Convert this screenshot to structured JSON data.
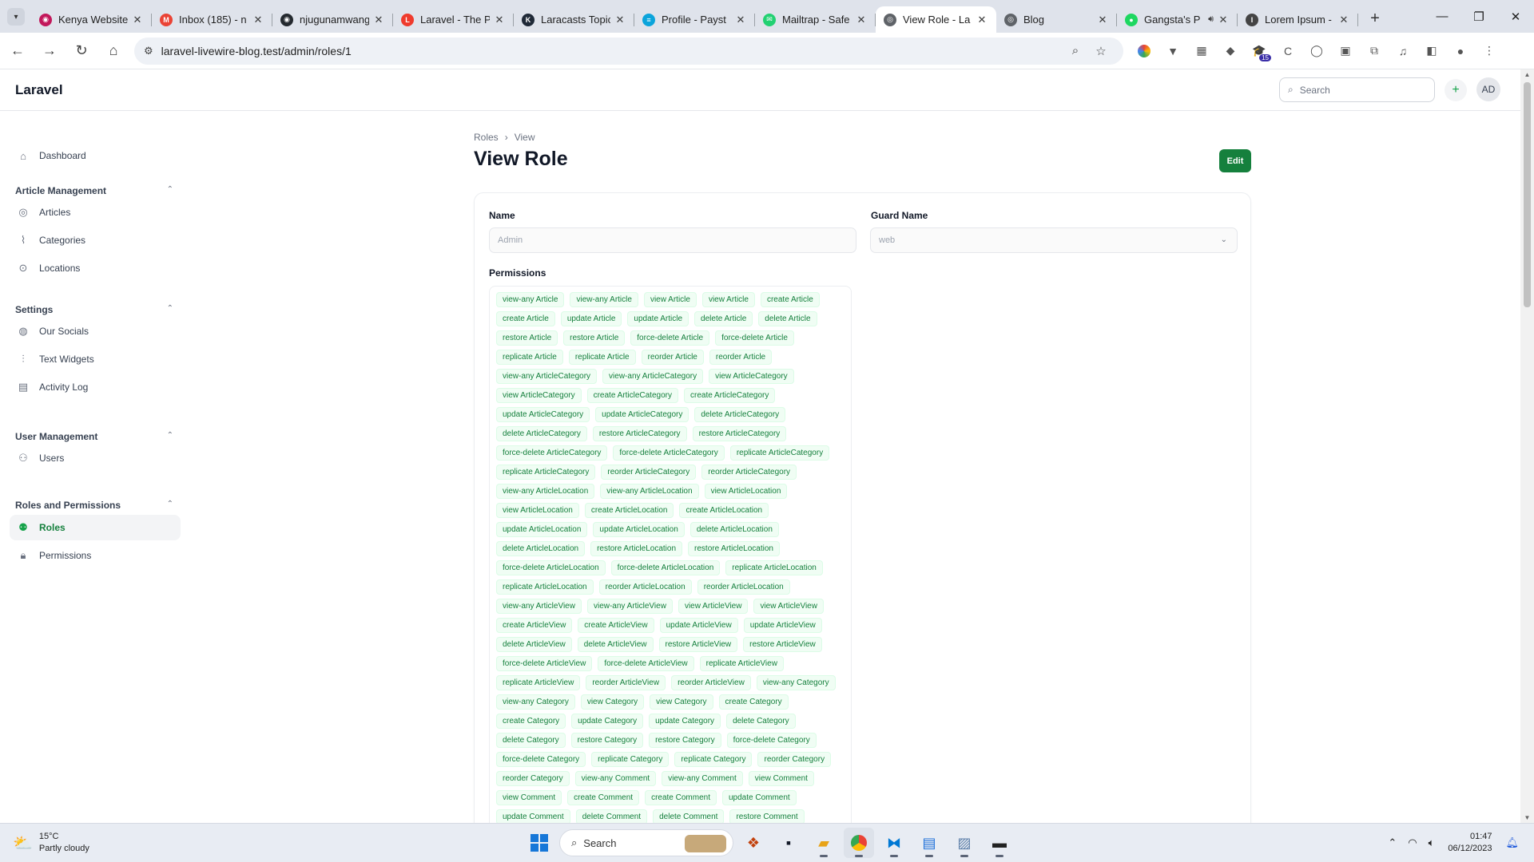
{
  "browser": {
    "tabs": [
      {
        "title": "Kenya Website",
        "favicon_color": "#c2185b",
        "favicon": "◉"
      },
      {
        "title": "Inbox (185) - n",
        "favicon_color": "#ea4335",
        "favicon": "M"
      },
      {
        "title": "njugunamwang",
        "favicon_color": "#24292f",
        "favicon": "◉"
      },
      {
        "title": "Laravel - The P",
        "favicon_color": "#ef3b2d",
        "favicon": "L"
      },
      {
        "title": "Laracasts Topic",
        "favicon_color": "#1f2937",
        "favicon": "K"
      },
      {
        "title": "Profile - Payst",
        "favicon_color": "#0ba4db",
        "favicon": "≡"
      },
      {
        "title": "Mailtrap - Safe",
        "favicon_color": "#22d172",
        "favicon": "✉"
      },
      {
        "title": "View Role - La",
        "favicon_color": "#5f6368",
        "favicon": "◎",
        "active": true
      },
      {
        "title": "Blog",
        "favicon_color": "#5f6368",
        "favicon": "◎"
      },
      {
        "title": "Gangsta's P",
        "favicon_color": "#1ed760",
        "favicon": "●",
        "audio": true
      },
      {
        "title": "Lorem Ipsum -",
        "favicon_color": "#444444",
        "favicon": "I"
      }
    ],
    "url": "laravel-livewire-blog.test/admin/roles/1",
    "extension_badge": "15"
  },
  "app": {
    "brand": "Laravel",
    "search_placeholder": "Search",
    "avatar_initials": "AD"
  },
  "sidebar": {
    "dashboard": "Dashboard",
    "groups": {
      "article_management": "Article Management",
      "settings": "Settings",
      "user_management": "User Management",
      "roles_and_permissions": "Roles and Permissions"
    },
    "items": {
      "articles": "Articles",
      "categories": "Categories",
      "locations": "Locations",
      "our_socials": "Our Socials",
      "text_widgets": "Text Widgets",
      "activity_log": "Activity Log",
      "users": "Users",
      "roles": "Roles",
      "permissions": "Permissions"
    }
  },
  "page": {
    "breadcrumb": [
      "Roles",
      "View"
    ],
    "title": "View Role",
    "edit_label": "Edit",
    "form": {
      "name_label": "Name",
      "name_value": "Admin",
      "guard_label": "Guard Name",
      "guard_value": "web",
      "permissions_label": "Permissions"
    },
    "permissions": [
      "view-any Article",
      "view-any Article",
      "view Article",
      "view Article",
      "create Article",
      "create Article",
      "update Article",
      "update Article",
      "delete Article",
      "delete Article",
      "restore Article",
      "restore Article",
      "force-delete Article",
      "force-delete Article",
      "replicate Article",
      "replicate Article",
      "reorder Article",
      "reorder Article",
      "view-any ArticleCategory",
      "view-any ArticleCategory",
      "view ArticleCategory",
      "view ArticleCategory",
      "create ArticleCategory",
      "create ArticleCategory",
      "update ArticleCategory",
      "update ArticleCategory",
      "delete ArticleCategory",
      "delete ArticleCategory",
      "restore ArticleCategory",
      "restore ArticleCategory",
      "force-delete ArticleCategory",
      "force-delete ArticleCategory",
      "replicate ArticleCategory",
      "replicate ArticleCategory",
      "reorder ArticleCategory",
      "reorder ArticleCategory",
      "view-any ArticleLocation",
      "view-any ArticleLocation",
      "view ArticleLocation",
      "view ArticleLocation",
      "create ArticleLocation",
      "create ArticleLocation",
      "update ArticleLocation",
      "update ArticleLocation",
      "delete ArticleLocation",
      "delete ArticleLocation",
      "restore ArticleLocation",
      "restore ArticleLocation",
      "force-delete ArticleLocation",
      "force-delete ArticleLocation",
      "replicate ArticleLocation",
      "replicate ArticleLocation",
      "reorder ArticleLocation",
      "reorder ArticleLocation",
      "view-any ArticleView",
      "view-any ArticleView",
      "view ArticleView",
      "view ArticleView",
      "create ArticleView",
      "create ArticleView",
      "update ArticleView",
      "update ArticleView",
      "delete ArticleView",
      "delete ArticleView",
      "restore ArticleView",
      "restore ArticleView",
      "force-delete ArticleView",
      "force-delete ArticleView",
      "replicate ArticleView",
      "replicate ArticleView",
      "reorder ArticleView",
      "reorder ArticleView",
      "view-any Category",
      "view-any Category",
      "view Category",
      "view Category",
      "create Category",
      "create Category",
      "update Category",
      "update Category",
      "delete Category",
      "delete Category",
      "restore Category",
      "restore Category",
      "force-delete Category",
      "force-delete Category",
      "replicate Category",
      "replicate Category",
      "reorder Category",
      "reorder Category",
      "view-any Comment",
      "view-any Comment",
      "view Comment",
      "view Comment",
      "create Comment",
      "create Comment",
      "update Comment",
      "update Comment",
      "delete Comment",
      "delete Comment",
      "restore Comment"
    ]
  },
  "taskbar": {
    "temperature": "15°C",
    "weather": "Partly cloudy",
    "search_label": "Search",
    "time": "01:47",
    "date": "06/12/2023"
  },
  "colors": {
    "primary": "#15803d",
    "chip_bg": "#f0fdf4",
    "chip_text": "#15803d"
  }
}
